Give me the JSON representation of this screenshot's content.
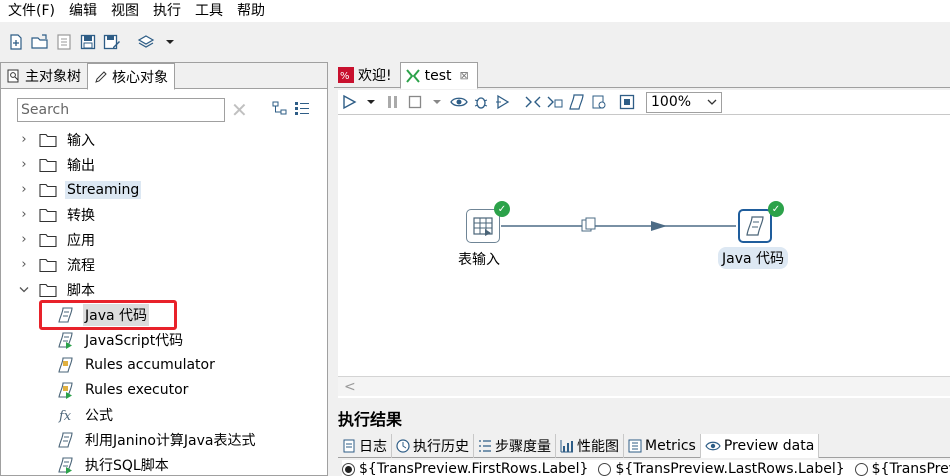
{
  "menu": [
    "文件(F)",
    "编辑",
    "视图",
    "执行",
    "工具",
    "帮助"
  ],
  "left_tabs": {
    "main_tree": "主对象树",
    "core_objects": "核心对象"
  },
  "search": {
    "placeholder": "Search"
  },
  "tree": {
    "folders": [
      {
        "label": "输入",
        "expanded": false,
        "highlighted": false
      },
      {
        "label": "输出",
        "expanded": false,
        "highlighted": false
      },
      {
        "label": "Streaming",
        "expanded": false,
        "highlighted": true
      },
      {
        "label": "转换",
        "expanded": false,
        "highlighted": false
      },
      {
        "label": "应用",
        "expanded": false,
        "highlighted": false
      },
      {
        "label": "流程",
        "expanded": false,
        "highlighted": false
      },
      {
        "label": "脚本",
        "expanded": true,
        "highlighted": false
      }
    ],
    "script_items": [
      {
        "label": "Java 代码",
        "icon": "java-code-icon",
        "selected": true
      },
      {
        "label": "JavaScript代码",
        "icon": "javascript-icon",
        "selected": false
      },
      {
        "label": "Rules accumulator",
        "icon": "rules-accumulator-icon",
        "selected": false
      },
      {
        "label": "Rules executor",
        "icon": "rules-executor-icon",
        "selected": false
      },
      {
        "label": "公式",
        "icon": "formula-icon",
        "selected": false
      },
      {
        "label": "利用Janino计算Java表达式",
        "icon": "janino-icon",
        "selected": false
      },
      {
        "label": "执行SQL脚本",
        "icon": "sql-script-icon",
        "selected": false
      }
    ]
  },
  "right_tabs": [
    {
      "label": "欢迎!",
      "icon": "welcome-icon"
    },
    {
      "label": "test",
      "icon": "transformation-icon",
      "closable": true,
      "close_glyph": "⊠"
    }
  ],
  "zoom": {
    "value": "100%"
  },
  "canvas": {
    "steps": [
      {
        "label": "表输入",
        "icon": "table-input-icon"
      },
      {
        "label": "Java 代码",
        "icon": "java-code-icon"
      }
    ],
    "scroll_left_glyph": "<"
  },
  "results": {
    "title": "执行结果",
    "tabs": [
      "日志",
      "执行历史",
      "步骤度量",
      "性能图",
      "Metrics",
      "Preview data"
    ],
    "options": [
      "${TransPreview.FirstRows.Label}",
      "${TransPreview.LastRows.Label}",
      "${TransPrev"
    ]
  },
  "colors": {
    "highlight_box": "#e8222a",
    "check_green": "#2ca24a",
    "step_border_active": "#1f5d9c",
    "hop_color": "#4d6c86"
  }
}
